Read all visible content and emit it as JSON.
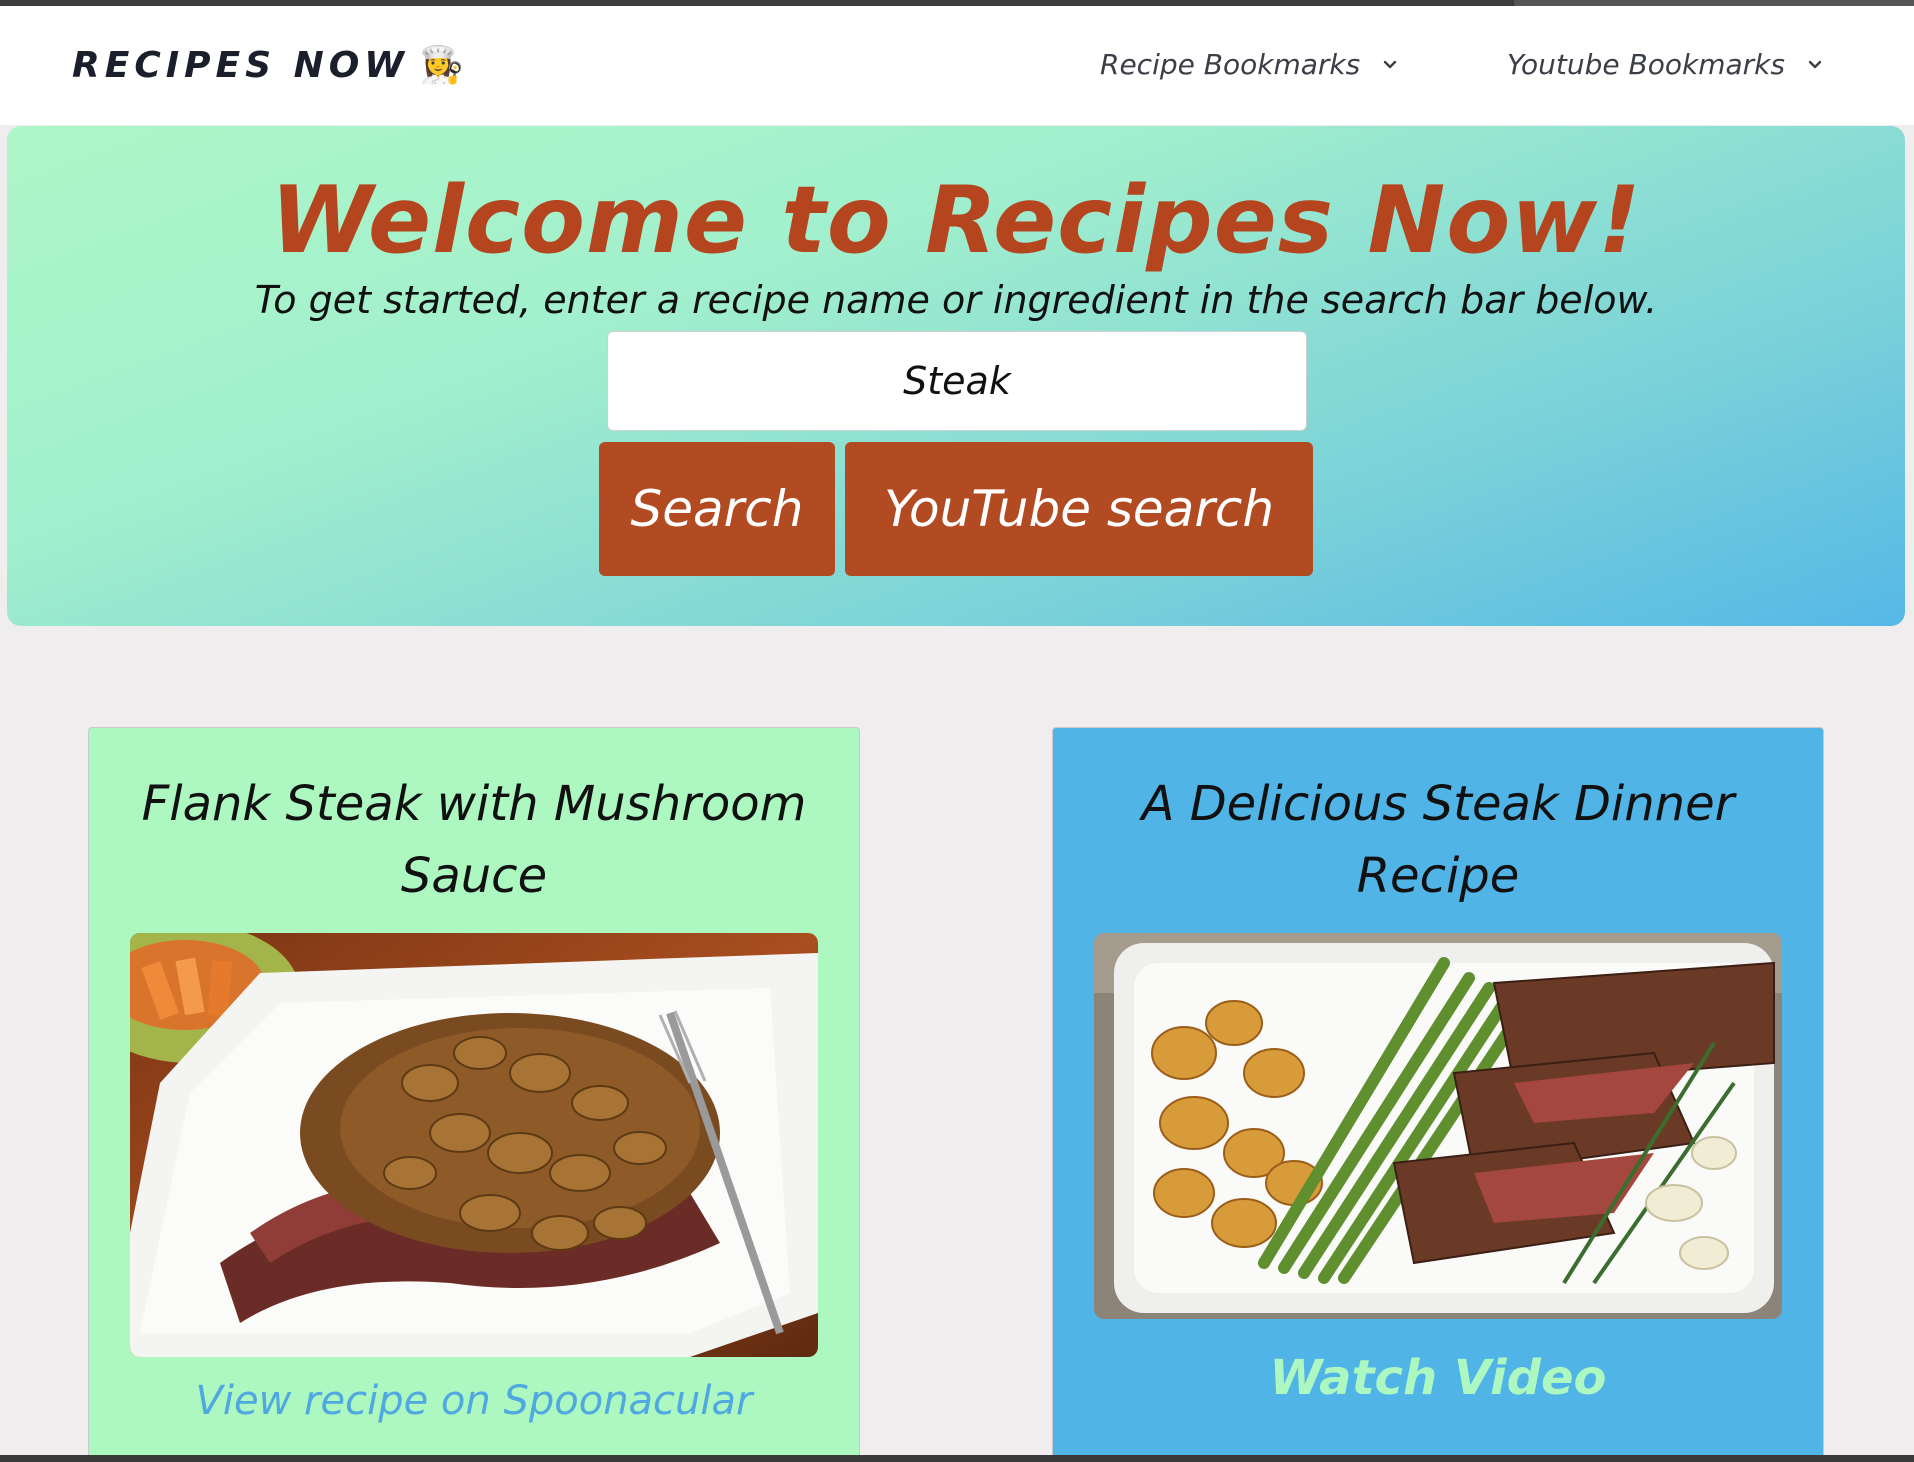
{
  "navbar": {
    "brand": "RECIPES NOW",
    "brand_icon": "👩‍🍳",
    "dropdowns": [
      {
        "label": "Recipe Bookmarks"
      },
      {
        "label": "Youtube Bookmarks"
      }
    ]
  },
  "hero": {
    "title": "Welcome to Recipes Now!",
    "subtitle": "To get started, enter a recipe name or ingredient in the search bar below.",
    "search_value": "Steak",
    "search_button": "Search",
    "youtube_button": "YouTube search"
  },
  "cards": [
    {
      "title": "Flank Steak with Mushroom Sauce",
      "image": "flank-steak-mushroom-sauce-photo",
      "link": "View recipe on Spoonacular",
      "bg_color": "#adf7c1",
      "link_color": "#4fa8e0"
    },
    {
      "title": "A Delicious Steak Dinner Recipe",
      "image": "steak-asparagus-potatoes-photo",
      "link": "Watch Video",
      "bg_color": "#51b4e6",
      "link_color": "#adf7c1"
    }
  ],
  "colors": {
    "accent": "#b24a22",
    "hero_gradient_start": "#adf7c8",
    "hero_gradient_end": "#56b8e6",
    "page_bg": "#efeded"
  }
}
